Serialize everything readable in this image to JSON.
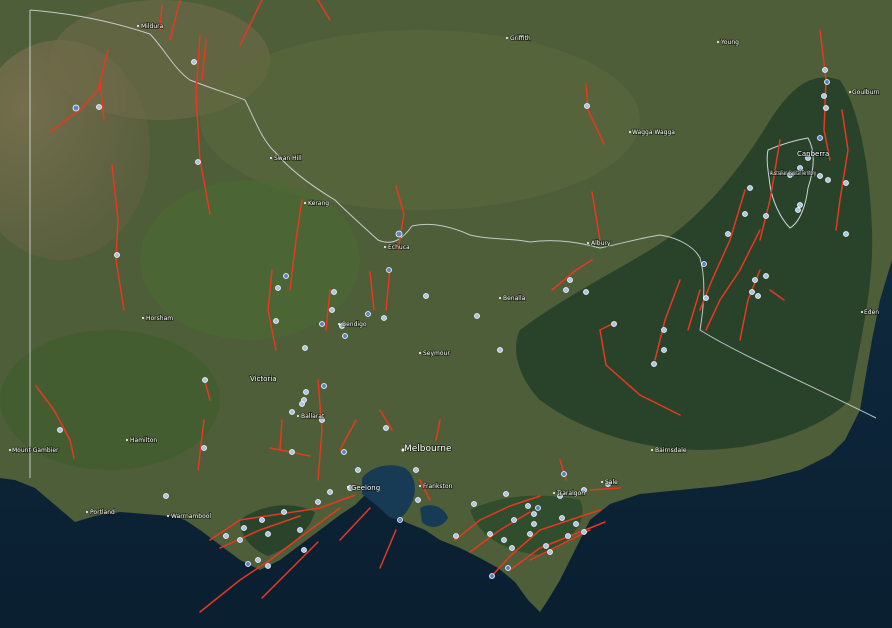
{
  "map": {
    "colors": {
      "ocean": "#0e2a3e",
      "land_dry": "#6d6a48",
      "land_green": "#3e5a2e",
      "forest": "#233d20",
      "fault_line": "#e8381e",
      "earthquake_marker": "#a9c4e6",
      "earthquake_marker_strong": "#5b86c9",
      "border": "#d8dde0",
      "label": "#ffffff"
    },
    "places": [
      {
        "id": "mildura",
        "name": "Mildura"
      },
      {
        "id": "griffith",
        "name": "Griffith"
      },
      {
        "id": "young",
        "name": "Young"
      },
      {
        "id": "goulburn",
        "name": "Goulburn"
      },
      {
        "id": "wagga",
        "name": "Wagga Wagga"
      },
      {
        "id": "canberra",
        "name": "Canberra"
      },
      {
        "id": "act",
        "name": "Australian Capital Territory"
      },
      {
        "id": "swanhill",
        "name": "Swan Hill"
      },
      {
        "id": "kerang",
        "name": "Kerang"
      },
      {
        "id": "echuca",
        "name": "Echuca"
      },
      {
        "id": "albury",
        "name": "Albury"
      },
      {
        "id": "benalla",
        "name": "Benalla"
      },
      {
        "id": "horsham",
        "name": "Horsham"
      },
      {
        "id": "bendigo",
        "name": "Bendigo"
      },
      {
        "id": "seymour",
        "name": "Seymour"
      },
      {
        "id": "victoria",
        "name": "Victoria"
      },
      {
        "id": "ballarat",
        "name": "Ballarat"
      },
      {
        "id": "melbourne",
        "name": "Melbourne"
      },
      {
        "id": "hamilton",
        "name": "Hamilton"
      },
      {
        "id": "mtgambier",
        "name": "Mount Gambier"
      },
      {
        "id": "portland",
        "name": "Portland"
      },
      {
        "id": "warrnambool",
        "name": "Warrnambool"
      },
      {
        "id": "geelong",
        "name": "Geelong"
      },
      {
        "id": "frankston",
        "name": "Frankston"
      },
      {
        "id": "traralgon",
        "name": "Traralgon"
      },
      {
        "id": "sale",
        "name": "Sale"
      },
      {
        "id": "bairnsdale",
        "name": "Bairnsdale"
      },
      {
        "id": "eden",
        "name": "Eden"
      }
    ]
  }
}
